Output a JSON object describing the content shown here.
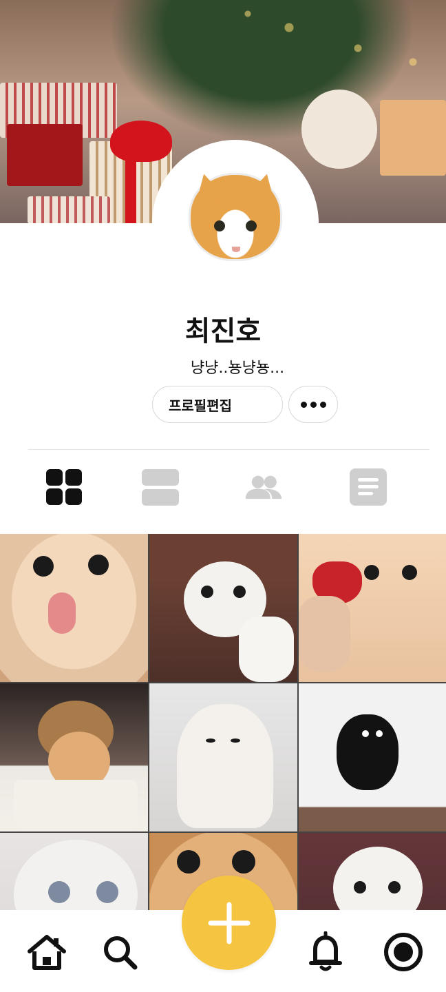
{
  "profile": {
    "name": "최진호",
    "bio": "냥냥..뇽냥뇽...",
    "edit_label": "프로필편집",
    "more_icon": "more-horizontal-icon"
  },
  "cover": {
    "description_icon": "christmas-gifts-cover-image"
  },
  "tabs": [
    {
      "icon": "grid-icon",
      "active": true
    },
    {
      "icon": "list-icon",
      "active": false
    },
    {
      "icon": "friends-icon",
      "active": false
    },
    {
      "icon": "text-post-icon",
      "active": false
    }
  ],
  "photos": [
    {
      "subject": "cat-tongue"
    },
    {
      "subject": "white-cat-smile"
    },
    {
      "subject": "cat-strawberry"
    },
    {
      "subject": "cat-bear-hat"
    },
    {
      "subject": "white-fluffy-cat"
    },
    {
      "subject": "black-cat-jump"
    },
    {
      "subject": "white-cat-big-eyes"
    },
    {
      "subject": "orange-cat-closeup"
    },
    {
      "subject": "white-cat-smile-2"
    }
  ],
  "bottom_nav": [
    {
      "icon": "home-icon"
    },
    {
      "icon": "search-icon"
    },
    {
      "icon": "add-icon"
    },
    {
      "icon": "bell-icon"
    },
    {
      "icon": "profile-icon"
    }
  ],
  "colors": {
    "accent": "#f5c542",
    "active_tab": "#111111",
    "inactive_tab": "#cfcfcf"
  }
}
